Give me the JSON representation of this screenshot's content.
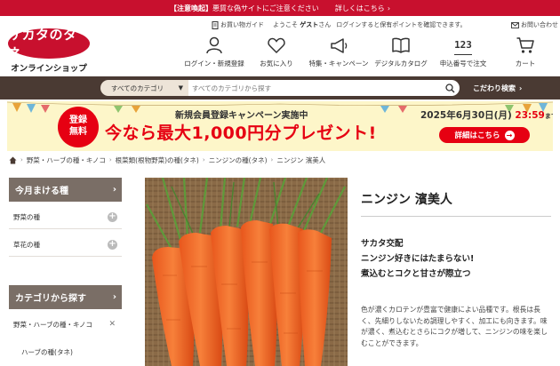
{
  "alert": {
    "tag": "【注意喚起】",
    "message": "悪質な偽サイトにご注意ください",
    "link": "詳しくはこちら"
  },
  "logo": {
    "main": "サカタのタネ",
    "sub": "オンラインショップ"
  },
  "utility": {
    "guide": "お買い物ガイド",
    "greeting_prefix": "ようこそ",
    "guest": "ゲスト",
    "greeting_suffix": "さん",
    "login_note": "ログインすると保有ポイントを確認できます。",
    "contact": "お問い合わせ"
  },
  "nav": [
    {
      "label": "ログイン・新規登録",
      "icon": "user-icon"
    },
    {
      "label": "お気に入り",
      "icon": "heart-icon"
    },
    {
      "label": "特集・キャンペーン",
      "icon": "megaphone-icon"
    },
    {
      "label": "デジタルカタログ",
      "icon": "book-icon"
    },
    {
      "label": "申込番号で注文",
      "number": "123"
    },
    {
      "label": "カート",
      "icon": "cart-icon"
    }
  ],
  "search": {
    "category": "すべてのカテゴリ",
    "placeholder": "すべてのカテゴリから探す",
    "advanced": "こだわり検索"
  },
  "banner": {
    "badge_line1": "登録",
    "badge_line2": "無料",
    "headline": "新規会員登録キャンペーン実施中",
    "main": "今なら最大1,000円分プレゼント!",
    "date": "2025年6月30日(月)",
    "time": "23:59",
    "time_suffix": "まで",
    "button": "詳細はこちら"
  },
  "breadcrumb": [
    "野菜・ハーブの種・キノコ",
    "根菜類(根物野菜)の種(タネ)",
    "ニンジンの種(タネ)",
    "ニンジン 濱美人"
  ],
  "sidebar": {
    "section1_title": "今月まける種",
    "section1_items": [
      "野菜の種",
      "草花の種"
    ],
    "section2_title": "カテゴリから探す",
    "section2_items": [
      "野菜・ハーブの種・キノコ"
    ],
    "section2_sub": [
      "ハーブの種(タネ)"
    ]
  },
  "product": {
    "title": "ニンジン 濱美人",
    "tagline1": "サカタ交配",
    "tagline2": "ニンジン好きにはたまらない!",
    "tagline3": "煮込むとコクと甘さが際立つ",
    "description": "色が濃くカロテンが豊富で健康によい品種です。根長は長く、先細りしないため調理しやすく、加工にも向きます。味が濃く、煮込むとさらにコクが増して、ニンジンの味を楽しむことができます。"
  },
  "colors": {
    "brand_red": "#c8102e",
    "search_bar": "#4a3a33",
    "sidebar_head": "#7a6e66",
    "banner_bg": "#fdf6c9",
    "accent_red": "#e60012"
  }
}
